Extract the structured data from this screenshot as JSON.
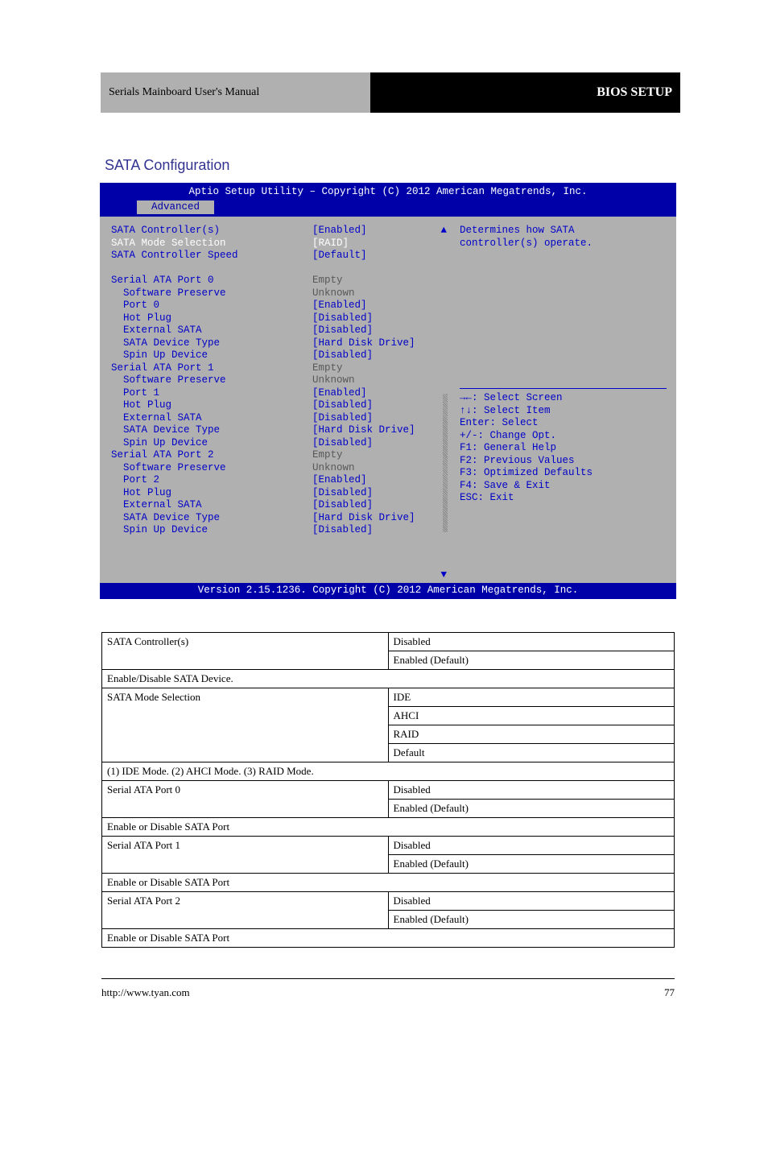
{
  "header": {
    "gray_text": "Serials Mainboard User's Manual",
    "black_text": "BIOS SETUP"
  },
  "section_title": "SATA Configuration",
  "bios": {
    "top_title": "Aptio Setup Utility – Copyright (C) 2012 American Megatrends, Inc.",
    "tab": "Advanced",
    "bottom": "Version 2.15.1236. Copyright (C) 2012 American Megatrends, Inc.",
    "help_desc_1": "Determines how SATA",
    "help_desc_2": "controller(s) operate.",
    "nav_keys": {
      "k1": "→←: Select Screen",
      "k2": "↑↓: Select Item",
      "k3": "Enter: Select",
      "k4": "+/-: Change Opt.",
      "k5": "F1: General Help",
      "k6": "F2: Previous Values",
      "k7": "F3: Optimized Defaults",
      "k8": "F4: Save & Exit",
      "k9": "ESC: Exit"
    },
    "rows": [
      {
        "label": "SATA Controller(s)",
        "value": "[Enabled]",
        "lcolor": "c-blue",
        "vcolor": "c-blue",
        "indent": 0
      },
      {
        "label": "SATA Mode Selection",
        "value": "[RAID]",
        "lcolor": "c-white",
        "vcolor": "c-white",
        "indent": 0
      },
      {
        "label": "SATA Controller Speed",
        "value": "[Default]",
        "lcolor": "c-blue",
        "vcolor": "c-blue",
        "indent": 0
      },
      {
        "label": "",
        "value": "",
        "lcolor": "",
        "vcolor": "",
        "indent": 0
      },
      {
        "label": "Serial ATA Port 0",
        "value": "Empty",
        "lcolor": "c-blue",
        "vcolor": "c-gray",
        "indent": 0
      },
      {
        "label": "Software Preserve",
        "value": "Unknown",
        "lcolor": "c-blue",
        "vcolor": "c-gray",
        "indent": 1
      },
      {
        "label": "Port 0",
        "value": "[Enabled]",
        "lcolor": "c-blue",
        "vcolor": "c-blue",
        "indent": 1
      },
      {
        "label": "Hot Plug",
        "value": "[Disabled]",
        "lcolor": "c-blue",
        "vcolor": "c-blue",
        "indent": 1
      },
      {
        "label": "External SATA",
        "value": "[Disabled]",
        "lcolor": "c-blue",
        "vcolor": "c-blue",
        "indent": 1
      },
      {
        "label": "SATA Device Type",
        "value": "[Hard Disk Drive]",
        "lcolor": "c-blue",
        "vcolor": "c-blue",
        "indent": 1
      },
      {
        "label": "Spin Up Device",
        "value": "[Disabled]",
        "lcolor": "c-blue",
        "vcolor": "c-blue",
        "indent": 1
      },
      {
        "label": "Serial ATA Port 1",
        "value": "Empty",
        "lcolor": "c-blue",
        "vcolor": "c-gray",
        "indent": 0
      },
      {
        "label": "Software Preserve",
        "value": "Unknown",
        "lcolor": "c-blue",
        "vcolor": "c-gray",
        "indent": 1
      },
      {
        "label": "Port 1",
        "value": "[Enabled]",
        "lcolor": "c-blue",
        "vcolor": "c-blue",
        "indent": 1
      },
      {
        "label": "Hot Plug",
        "value": "[Disabled]",
        "lcolor": "c-blue",
        "vcolor": "c-blue",
        "indent": 1
      },
      {
        "label": "External SATA",
        "value": "[Disabled]",
        "lcolor": "c-blue",
        "vcolor": "c-blue",
        "indent": 1
      },
      {
        "label": "SATA Device Type",
        "value": "[Hard Disk Drive]",
        "lcolor": "c-blue",
        "vcolor": "c-blue",
        "indent": 1
      },
      {
        "label": "Spin Up Device",
        "value": "[Disabled]",
        "lcolor": "c-blue",
        "vcolor": "c-blue",
        "indent": 1
      },
      {
        "label": "Serial ATA Port 2",
        "value": "Empty",
        "lcolor": "c-blue",
        "vcolor": "c-gray",
        "indent": 0
      },
      {
        "label": "Software Preserve",
        "value": "Unknown",
        "lcolor": "c-blue",
        "vcolor": "c-gray",
        "indent": 1
      },
      {
        "label": "Port 2",
        "value": "[Enabled]",
        "lcolor": "c-blue",
        "vcolor": "c-blue",
        "indent": 1
      },
      {
        "label": "Hot Plug",
        "value": "[Disabled]",
        "lcolor": "c-blue",
        "vcolor": "c-blue",
        "indent": 1
      },
      {
        "label": "External SATA",
        "value": "[Disabled]",
        "lcolor": "c-blue",
        "vcolor": "c-blue",
        "indent": 1
      },
      {
        "label": "SATA Device Type",
        "value": "[Hard Disk Drive]",
        "lcolor": "c-blue",
        "vcolor": "c-blue",
        "indent": 1
      },
      {
        "label": "Spin Up Device",
        "value": "[Disabled]",
        "lcolor": "c-blue",
        "vcolor": "c-blue",
        "indent": 1
      }
    ]
  },
  "table": {
    "rows": [
      {
        "type": "opt2",
        "h": "SATA Controller(s)",
        "o1": "Disabled",
        "o2": "Enabled (Default)"
      },
      {
        "type": "desc",
        "d": "Enable/Disable SATA Device."
      },
      {
        "type": "opt4",
        "h": "SATA Mode Selection",
        "o1": "IDE",
        "o2": "AHCI",
        "o3": "RAID",
        "o4": "Default"
      },
      {
        "type": "desc",
        "d": "(1) IDE Mode. (2) AHCI Mode. (3) RAID Mode."
      },
      {
        "type": "opt2",
        "h": "Serial ATA Port 0",
        "o1": "Disabled",
        "o2": "Enabled (Default)"
      },
      {
        "type": "desc",
        "d": "Enable or Disable SATA Port"
      },
      {
        "type": "opt2",
        "h": "Serial ATA Port 1",
        "o1": "Disabled",
        "o2": "Enabled (Default)"
      },
      {
        "type": "desc",
        "d": "Enable or Disable SATA Port"
      },
      {
        "type": "opt2",
        "h": "Serial ATA Port 2",
        "o1": "Disabled",
        "o2": "Enabled (Default)"
      },
      {
        "type": "desc",
        "d": "Enable or Disable SATA Port"
      }
    ]
  },
  "footer": {
    "left": "http://www.tyan.com",
    "right": "77"
  }
}
